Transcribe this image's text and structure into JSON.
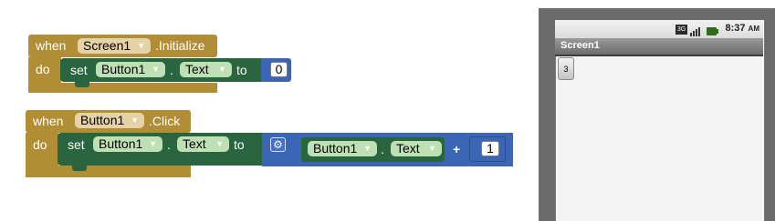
{
  "blocks": {
    "initialize": {
      "when": "when",
      "component": "Screen1",
      "event": ".Initialize",
      "do": "do",
      "set": "set",
      "target": "Button1",
      "dot": ".",
      "property": "Text",
      "to": "to",
      "value": "0"
    },
    "click": {
      "when": "when",
      "component": "Button1",
      "event": ".Click",
      "do": "do",
      "set": "set",
      "target": "Button1",
      "dot": ".",
      "property": "Text",
      "to": "to",
      "getter_component": "Button1",
      "getter_dot": ".",
      "getter_property": "Text",
      "plus": "+",
      "addend": "1"
    }
  },
  "phone": {
    "network": "3G",
    "time": "8:37",
    "ampm": "AM",
    "screen_title": "Screen1",
    "button_text": "3"
  },
  "colors": {
    "event_block": "#b18e35",
    "setter_block": "#29653e",
    "math_block": "#3a66b5"
  }
}
